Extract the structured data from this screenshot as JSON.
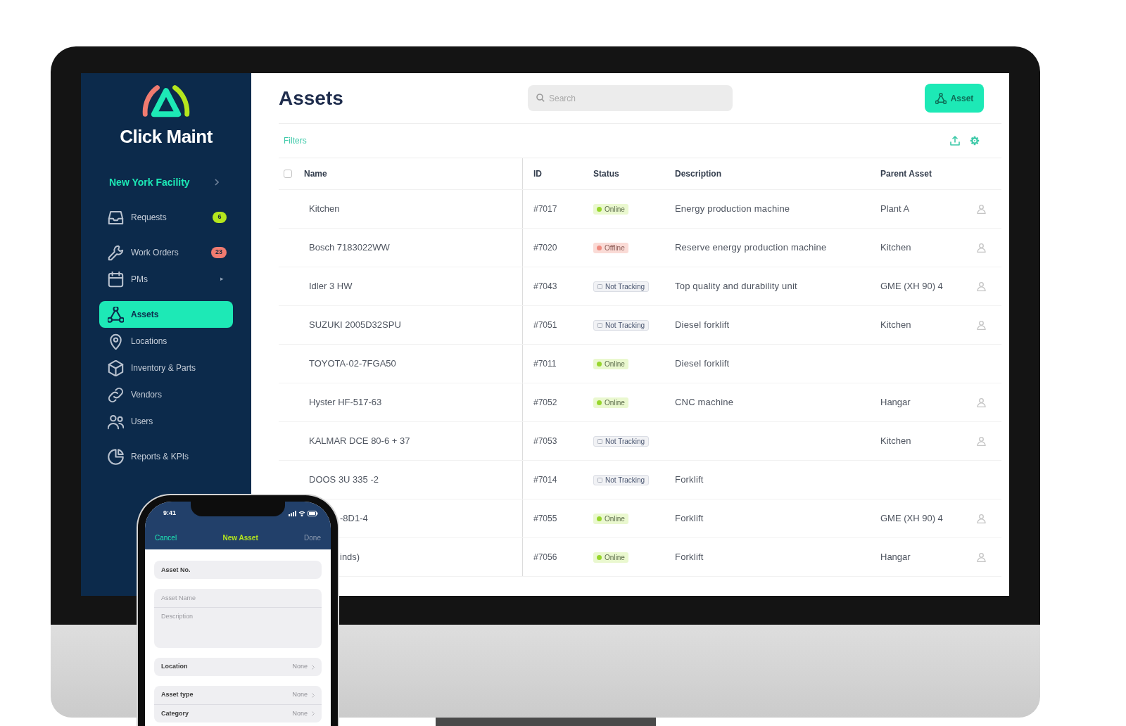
{
  "sidebar": {
    "logo_text": "Click Maint",
    "facility": {
      "label": "New York Facility"
    },
    "groups": [
      {
        "items": [
          {
            "label": "Requests",
            "selected": false,
            "badge": {
              "text": "6",
              "color": "#b5e61d"
            }
          }
        ]
      },
      {
        "items": [
          {
            "label": "Work Orders",
            "selected": false,
            "badge": {
              "text": "23",
              "color": "#f07b70"
            }
          },
          {
            "label": "PMs",
            "selected": false,
            "caret": "▸"
          }
        ]
      },
      {
        "items": [
          {
            "label": "Assets",
            "selected": true
          },
          {
            "label": "Locations",
            "selected": false
          },
          {
            "label": "Inventory & Parts",
            "selected": false
          },
          {
            "label": "Vendors",
            "selected": false
          },
          {
            "label": "Users",
            "selected": false
          }
        ]
      },
      {
        "items": [
          {
            "label": "Reports & KPIs",
            "selected": false
          }
        ]
      }
    ]
  },
  "main": {
    "title": "Assets",
    "search": {
      "placeholder": "Search"
    },
    "add_button": {
      "label": "Asset"
    },
    "filters_link": "Filters",
    "table": {
      "select_all": {
        "checked": false
      },
      "columns": [
        "Name",
        "ID",
        "Status",
        "Description",
        "Parent Asset"
      ],
      "rows": [
        {
          "name": "Kitchen",
          "id": "#7017",
          "status": {
            "label": "Online",
            "kind": "online"
          },
          "description": "Energy production machine",
          "parent": "Plant A",
          "has_icon": true,
          "cut": false
        },
        {
          "name": "Bosch 7183022WW",
          "id": "#7020",
          "status": {
            "label": "Offline",
            "kind": "offline"
          },
          "description": "Reserve energy production machine",
          "parent": "Kitchen",
          "has_icon": true,
          "cut": false
        },
        {
          "name": "Idler 3 HW",
          "id": "#7043",
          "status": {
            "label": "Not Tracking",
            "kind": "not_tracking"
          },
          "description": "Top quality and durability unit",
          "parent": "GME (XH 90) 4",
          "has_icon": true,
          "cut": false
        },
        {
          "name": "SUZUKI 2005D32SPU",
          "id": "#7051",
          "status": {
            "label": "Not Tracking",
            "kind": "not_tracking"
          },
          "description": "Diesel forklift",
          "parent": "Kitchen",
          "has_icon": true,
          "cut": false
        },
        {
          "name": "TOYOTA-02-7FGA50",
          "id": "#7011",
          "status": {
            "label": "Online",
            "kind": "online"
          },
          "description": "Diesel forklift",
          "has_icon": false,
          "cut": false
        },
        {
          "name": "Hyster HF-517-63",
          "id": "#7052",
          "status": {
            "label": "Online",
            "kind": "online"
          },
          "description": "CNC machine",
          "parent": "Hangar",
          "has_icon": true,
          "cut": false
        },
        {
          "name": "KALMAR DCE 80-6 + 37",
          "id": "#7053",
          "status": {
            "label": "Not Tracking",
            "kind": "not_tracking"
          },
          "parent": "Kitchen",
          "has_icon": true,
          "cut": false
        },
        {
          "name": "DOOS 3U 335 -2",
          "id": "#7014",
          "status": {
            "label": "Not Tracking",
            "kind": "not_tracking"
          },
          "description": "Forklift",
          "has_icon": false,
          "cut": false
        },
        {
          "name": "-8D1-4",
          "id": "#7055",
          "status": {
            "label": "Online",
            "kind": "online"
          },
          "description": "Forklift",
          "parent": "GME (XH 90) 4",
          "has_icon": true,
          "cut": true
        },
        {
          "name": "inds)",
          "id": "#7056",
          "status": {
            "label": "Online",
            "kind": "online"
          },
          "description": "Forklift",
          "parent": "Hangar",
          "has_icon": true,
          "cut": true
        }
      ]
    }
  },
  "phone": {
    "time": "9:41",
    "nav": {
      "cancel": "Cancel",
      "title": "New Asset",
      "done": "Done"
    },
    "form": [
      {
        "rows": [
          {
            "kind": "input",
            "value": "Asset No."
          }
        ]
      },
      {
        "rows": [
          {
            "kind": "input",
            "placeholder": "Asset Name"
          },
          {
            "kind": "textarea",
            "placeholder": "Description"
          }
        ]
      },
      {
        "rows": [
          {
            "kind": "picker",
            "label": "Location",
            "value": "None"
          }
        ]
      },
      {
        "rows": [
          {
            "kind": "picker",
            "label": "Asset type",
            "value": "None"
          },
          {
            "kind": "picker",
            "label": "Category",
            "value": "None"
          }
        ]
      }
    ]
  }
}
